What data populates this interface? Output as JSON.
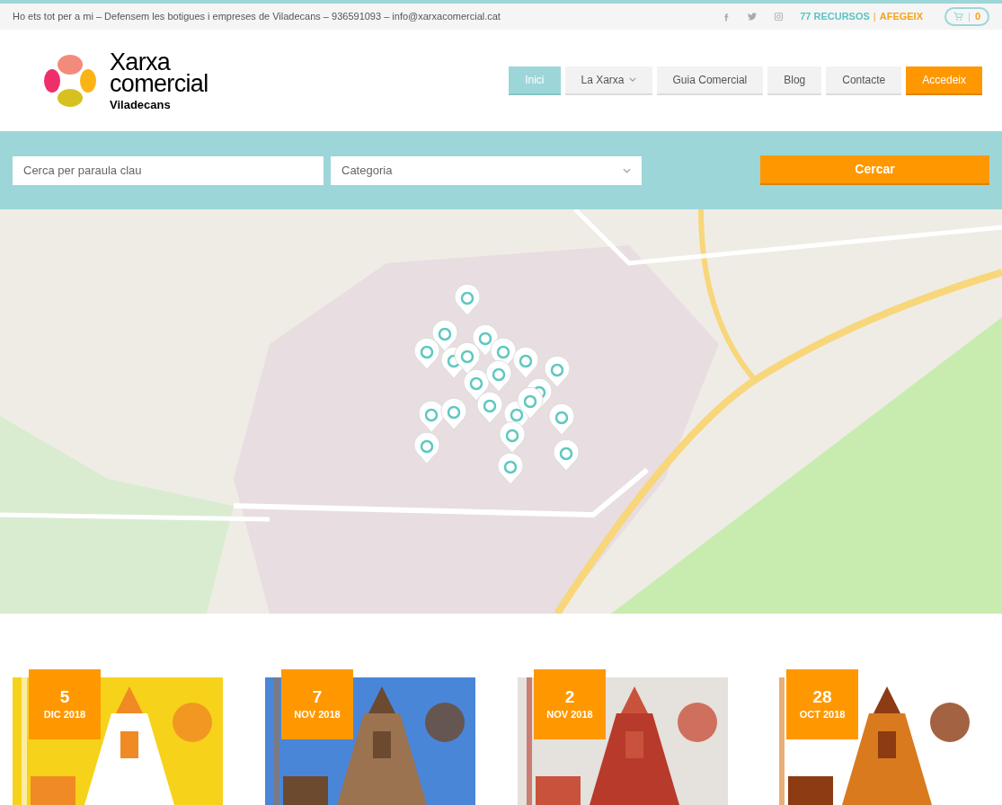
{
  "top_bar": {
    "tagline": "Ho ets tot per a mi – Defensem les botigues i empreses de Viladecans – 936591093 – info@xarxacomercial.cat",
    "resources": "77 RECURSOS",
    "separator": "|",
    "add": "AFEGEIX",
    "cart_count": "0"
  },
  "logo": {
    "line1": "Xarxa",
    "line2": "comercial",
    "line3": "Viladecans"
  },
  "nav": [
    {
      "label": "Inici",
      "selected": true,
      "kind": "link",
      "has_menu": false
    },
    {
      "label": "La Xarxa",
      "selected": false,
      "kind": "link",
      "has_menu": true
    },
    {
      "label": "Guia Comercial",
      "selected": false,
      "kind": "link",
      "has_menu": false
    },
    {
      "label": "Blog",
      "selected": false,
      "kind": "link",
      "has_menu": false
    },
    {
      "label": "Contacte",
      "selected": false,
      "kind": "link",
      "has_menu": false
    },
    {
      "label": "Accedeix",
      "selected": false,
      "kind": "cta",
      "has_menu": false
    }
  ],
  "search": {
    "placeholder": "Cerca per paraula clau",
    "category": "Categoria",
    "button": "Cercar"
  },
  "events": [
    {
      "day": "5",
      "month": "DIC 2018"
    },
    {
      "day": "7",
      "month": "NOV 2018"
    },
    {
      "day": "2",
      "month": "NOV 2018"
    },
    {
      "day": "28",
      "month": "OCT 2018"
    }
  ]
}
